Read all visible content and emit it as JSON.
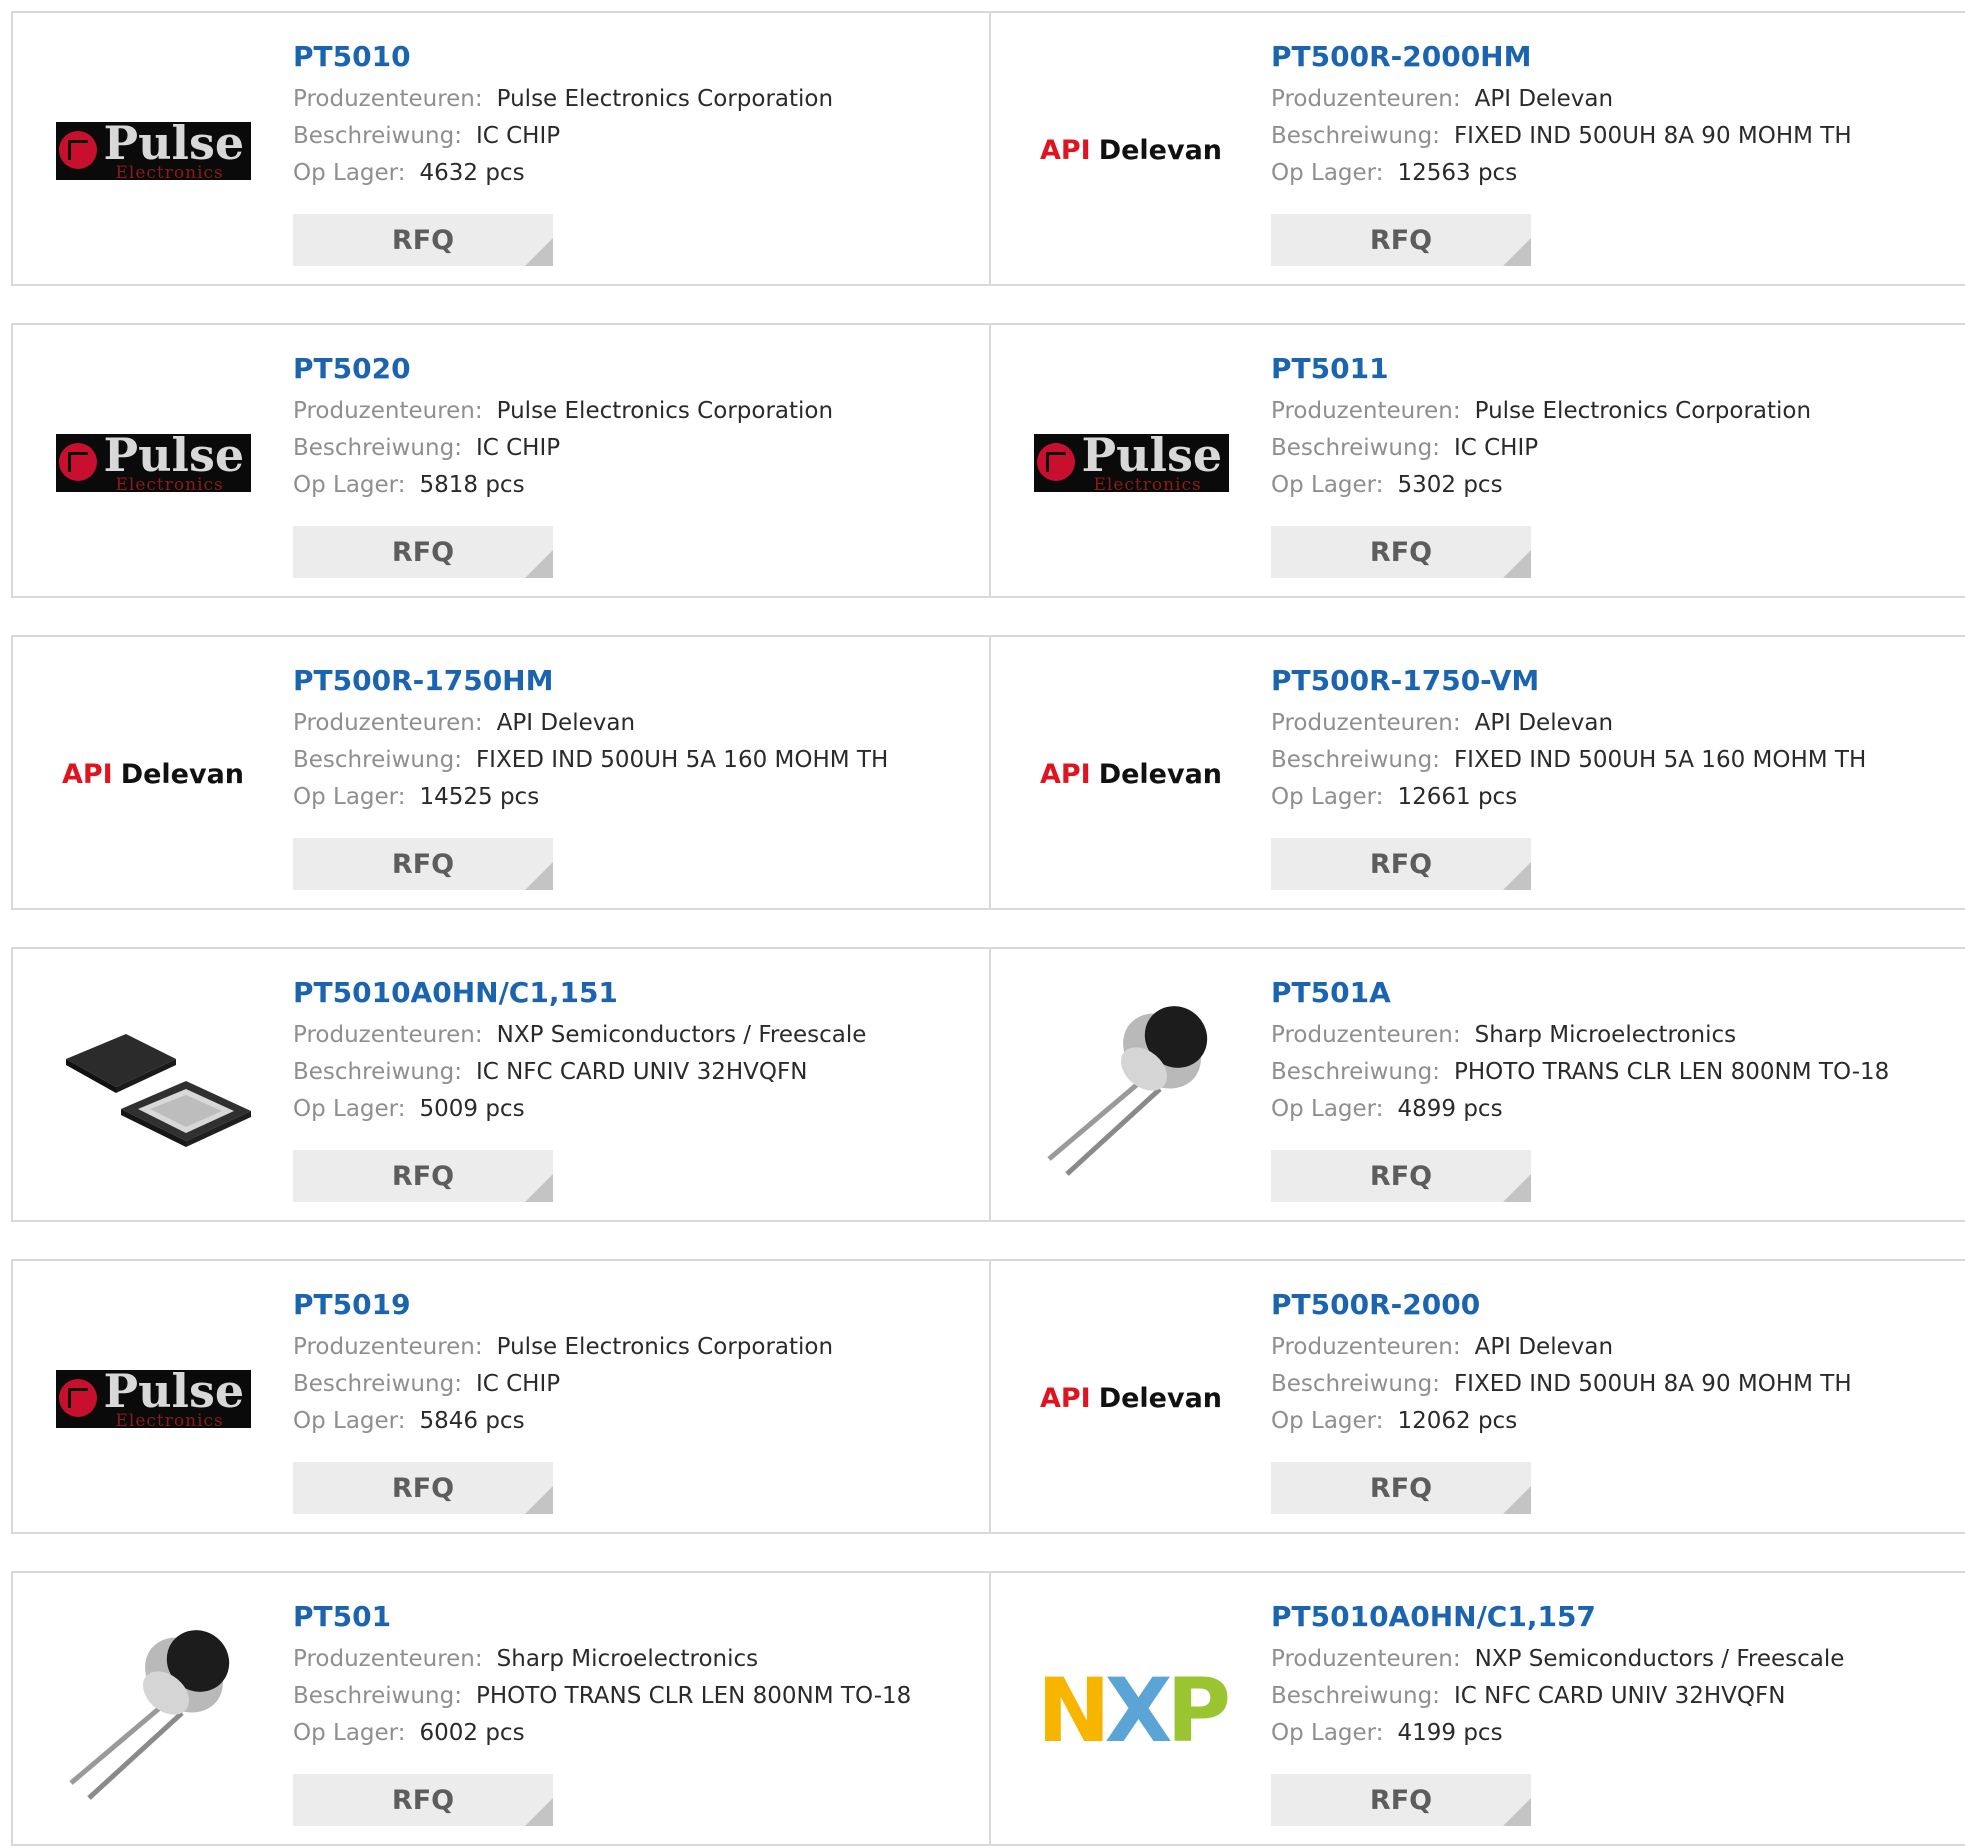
{
  "labels": {
    "manufacturer": "Produzenteuren:",
    "description": "Beschreiwung:",
    "stock": "Op Lager:",
    "rfq": "RFQ"
  },
  "products": [
    {
      "name": "PT5010",
      "manufacturer": "Pulse Electronics Corporation",
      "description": "IC CHIP",
      "stock": "4632 pcs",
      "image": "pulse-logo"
    },
    {
      "name": "PT500R-2000HM",
      "manufacturer": "API Delevan",
      "description": "FIXED IND 500UH 8A 90 MOHM TH",
      "stock": "12563 pcs",
      "image": "api-delevan-logo"
    },
    {
      "name": "PT5020",
      "manufacturer": "Pulse Electronics Corporation",
      "description": "IC CHIP",
      "stock": "5818 pcs",
      "image": "pulse-logo"
    },
    {
      "name": "PT5011",
      "manufacturer": "Pulse Electronics Corporation",
      "description": "IC CHIP",
      "stock": "5302 pcs",
      "image": "pulse-logo"
    },
    {
      "name": "PT500R-1750HM",
      "manufacturer": "API Delevan",
      "description": "FIXED IND 500UH 5A 160 MOHM TH",
      "stock": "14525 pcs",
      "image": "api-delevan-logo"
    },
    {
      "name": "PT500R-1750-VM",
      "manufacturer": "API Delevan",
      "description": "FIXED IND 500UH 5A 160 MOHM TH",
      "stock": "12661 pcs",
      "image": "api-delevan-logo"
    },
    {
      "name": "PT5010A0HN/C1,151",
      "manufacturer": "NXP Semiconductors / Freescale",
      "description": "IC NFC CARD UNIV 32HVQFN",
      "stock": "5009 pcs",
      "image": "qfn-chip-photo"
    },
    {
      "name": "PT501A",
      "manufacturer": "Sharp Microelectronics",
      "description": "PHOTO TRANS CLR LEN 800NM TO-18",
      "stock": "4899 pcs",
      "image": "phototransistor-photo"
    },
    {
      "name": "PT5019",
      "manufacturer": "Pulse Electronics Corporation",
      "description": "IC CHIP",
      "stock": "5846 pcs",
      "image": "pulse-logo"
    },
    {
      "name": "PT500R-2000",
      "manufacturer": "API Delevan",
      "description": "FIXED IND 500UH 8A 90 MOHM TH",
      "stock": "12062 pcs",
      "image": "api-delevan-logo"
    },
    {
      "name": "PT501",
      "manufacturer": "Sharp Microelectronics",
      "description": "PHOTO TRANS CLR LEN 800NM TO-18",
      "stock": "6002 pcs",
      "image": "phototransistor-photo"
    },
    {
      "name": "PT5010A0HN/C1,157",
      "manufacturer": "NXP Semiconductors / Freescale",
      "description": "IC NFC CARD UNIV 32HVQFN",
      "stock": "4199 pcs",
      "image": "nxp-logo"
    }
  ],
  "logo_text": {
    "pulse": {
      "word": "Pulse",
      "sub": "Electronics"
    },
    "api": {
      "brand": "API",
      "name": "Delevan"
    },
    "nxp": {
      "n": "N",
      "x": "X",
      "p": "P"
    }
  },
  "colors": {
    "product_link": "#1b64b0",
    "label": "#8f8f8f",
    "value": "#2a2a2a",
    "rfq_bg": "#ececec",
    "rfq_text": "#5d5d5d",
    "border": "#d9d9d9"
  }
}
